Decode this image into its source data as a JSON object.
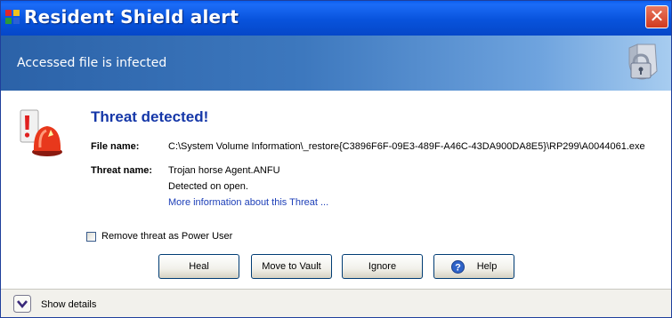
{
  "window": {
    "title": "Resident Shield alert",
    "close_symbol": "✕"
  },
  "header": {
    "subtitle": "Accessed file is infected",
    "icon": "shield-lock-icon"
  },
  "alert": {
    "icon": "siren-icon",
    "heading": "Threat detected!",
    "file_name_label": "File name:",
    "file_name_value": "C:\\System Volume Information\\_restore{C3896F6F-09E3-489F-A46C-43DA900DA8E5}\\RP299\\A0044061.exe",
    "threat_name_label": "Threat name:",
    "threat_name_value": "Trojan horse Agent.ANFU",
    "detected_text": "Detected on open.",
    "more_info_link": "More information about this Threat ..."
  },
  "options": {
    "remove_as_power_user_label": "Remove threat as Power User",
    "remove_as_power_user_checked": false
  },
  "buttons": {
    "heal": "Heal",
    "move_to_vault": "Move to Vault",
    "ignore": "Ignore",
    "help": "Help"
  },
  "footer": {
    "show_details": "Show details"
  },
  "colors": {
    "titlebar": "#0853dc",
    "heading": "#1537a8",
    "link": "#1d3fb8",
    "close": "#d1391f"
  }
}
